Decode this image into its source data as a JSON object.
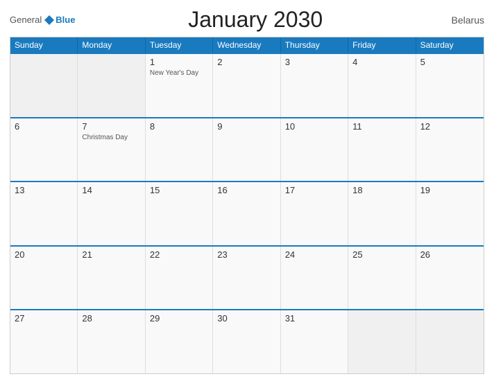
{
  "header": {
    "logo": {
      "general": "General",
      "blue": "Blue"
    },
    "title": "January 2030",
    "country": "Belarus"
  },
  "weekdays": [
    "Sunday",
    "Monday",
    "Tuesday",
    "Wednesday",
    "Thursday",
    "Friday",
    "Saturday"
  ],
  "weeks": [
    [
      {
        "day": "",
        "holiday": ""
      },
      {
        "day": "",
        "holiday": ""
      },
      {
        "day": "1",
        "holiday": "New Year's Day"
      },
      {
        "day": "2",
        "holiday": ""
      },
      {
        "day": "3",
        "holiday": ""
      },
      {
        "day": "4",
        "holiday": ""
      },
      {
        "day": "5",
        "holiday": ""
      }
    ],
    [
      {
        "day": "6",
        "holiday": ""
      },
      {
        "day": "7",
        "holiday": "Christmas Day"
      },
      {
        "day": "8",
        "holiday": ""
      },
      {
        "day": "9",
        "holiday": ""
      },
      {
        "day": "10",
        "holiday": ""
      },
      {
        "day": "11",
        "holiday": ""
      },
      {
        "day": "12",
        "holiday": ""
      }
    ],
    [
      {
        "day": "13",
        "holiday": ""
      },
      {
        "day": "14",
        "holiday": ""
      },
      {
        "day": "15",
        "holiday": ""
      },
      {
        "day": "16",
        "holiday": ""
      },
      {
        "day": "17",
        "holiday": ""
      },
      {
        "day": "18",
        "holiday": ""
      },
      {
        "day": "19",
        "holiday": ""
      }
    ],
    [
      {
        "day": "20",
        "holiday": ""
      },
      {
        "day": "21",
        "holiday": ""
      },
      {
        "day": "22",
        "holiday": ""
      },
      {
        "day": "23",
        "holiday": ""
      },
      {
        "day": "24",
        "holiday": ""
      },
      {
        "day": "25",
        "holiday": ""
      },
      {
        "day": "26",
        "holiday": ""
      }
    ],
    [
      {
        "day": "27",
        "holiday": ""
      },
      {
        "day": "28",
        "holiday": ""
      },
      {
        "day": "29",
        "holiday": ""
      },
      {
        "day": "30",
        "holiday": ""
      },
      {
        "day": "31",
        "holiday": ""
      },
      {
        "day": "",
        "holiday": ""
      },
      {
        "day": "",
        "holiday": ""
      }
    ]
  ]
}
